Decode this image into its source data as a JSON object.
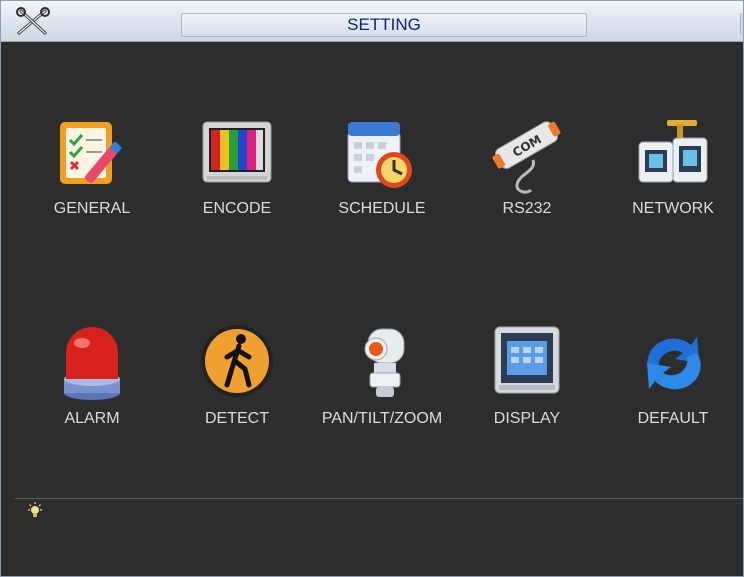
{
  "window": {
    "title": "SETTING"
  },
  "icons": {
    "title": "tools-icon",
    "hint": "lightbulb-icon"
  },
  "menu": {
    "items": [
      {
        "label": "GENERAL",
        "icon": "general-settings-icon"
      },
      {
        "label": "ENCODE",
        "icon": "encode-monitor-icon"
      },
      {
        "label": "SCHEDULE",
        "icon": "schedule-calendar-icon"
      },
      {
        "label": "RS232",
        "icon": "rs232-com-port-icon"
      },
      {
        "label": "NETWORK",
        "icon": "network-icon"
      },
      {
        "label": "ALARM",
        "icon": "alarm-siren-icon"
      },
      {
        "label": "DETECT",
        "icon": "detect-walking-person-icon"
      },
      {
        "label": "PAN/TILT/ZOOM",
        "icon": "ptz-camera-icon"
      },
      {
        "label": "DISPLAY",
        "icon": "display-monitor-icon"
      },
      {
        "label": "DEFAULT",
        "icon": "default-restore-icon"
      }
    ]
  },
  "colors": {
    "background": "#2d2d2d",
    "title_text": "#0f1c8c",
    "label_text": "#dcdcdc"
  }
}
